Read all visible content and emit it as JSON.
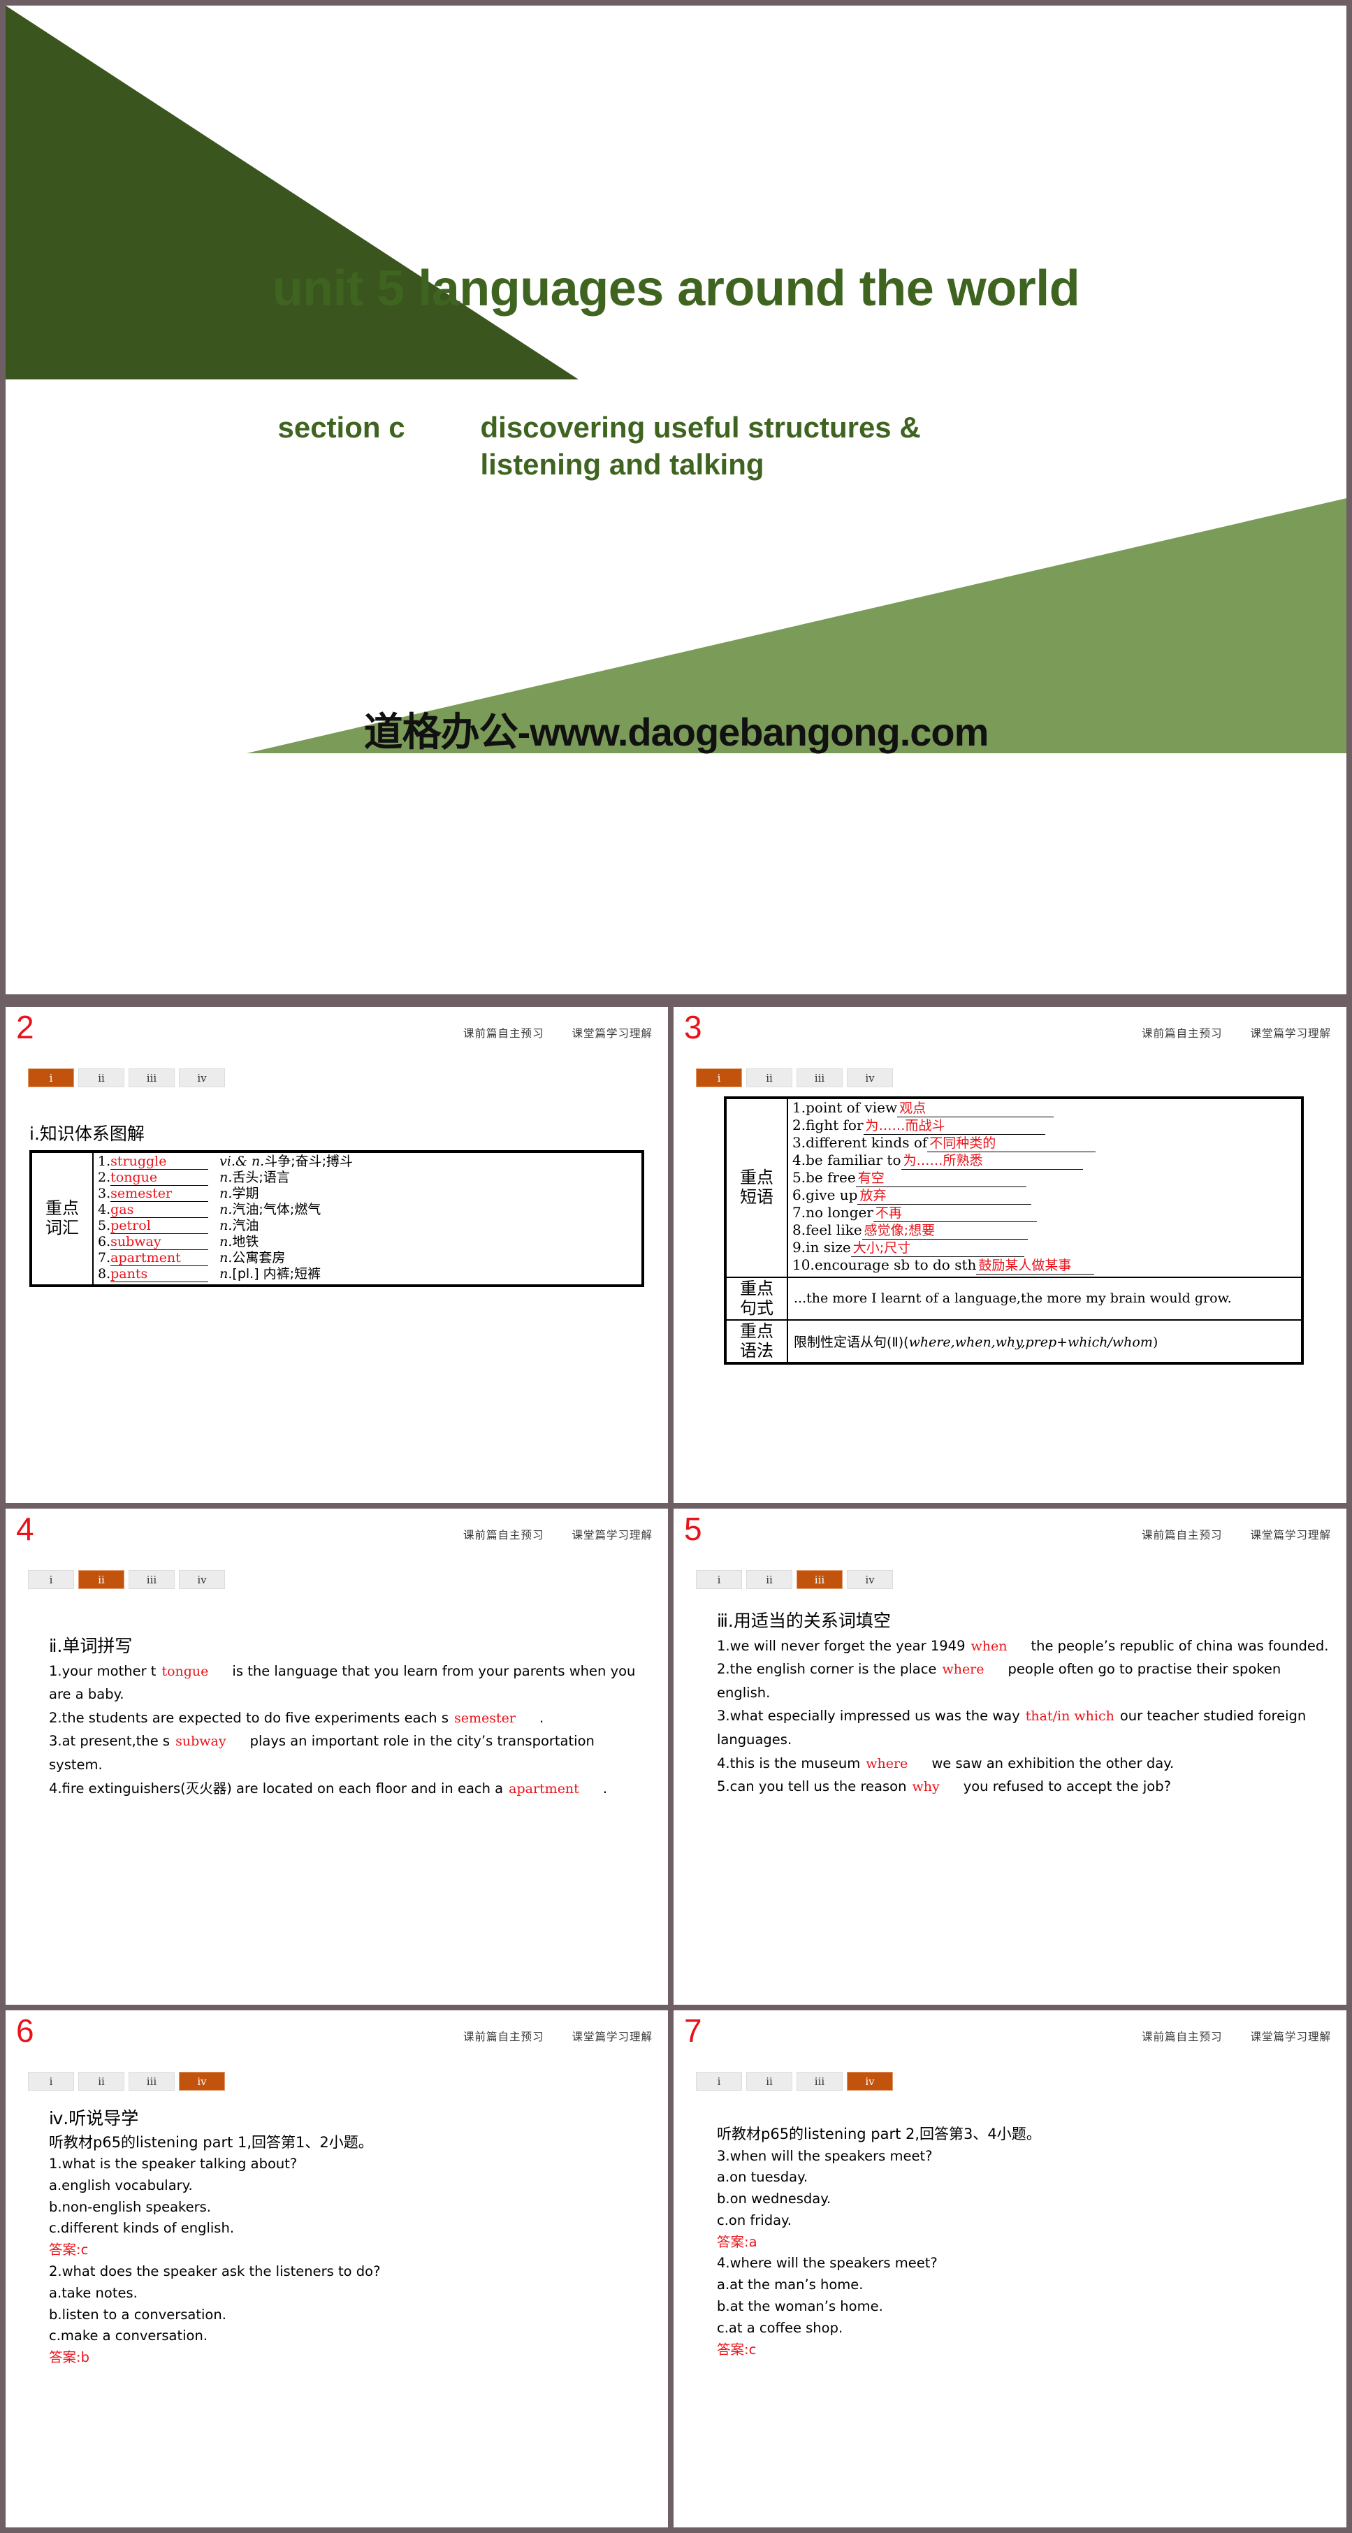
{
  "title_slide": {
    "main_title": "unit 5 languages around the world",
    "section_label": "section c",
    "subtitle_line1": "discovering useful structures &",
    "subtitle_line2": "listening and talking",
    "watermark": "道格办公-www.daogebangong.com",
    "colors": {
      "dark_green": "#3a551d",
      "light_green": "#7b9b58",
      "title_green": "#3e6420"
    }
  },
  "common": {
    "header_left": "课前篇自主预习",
    "header_right": "课堂篇学习理解",
    "tabs": [
      "i",
      "ii",
      "iii",
      "iv"
    ],
    "active_color": "#c1530d",
    "number_color": "#e8131a"
  },
  "slides": [
    {
      "number": "2",
      "active_tab": 0,
      "heading": "ⅰ.知识体系图解",
      "table": {
        "row_label": "重点\n词汇",
        "label_line1": "重点",
        "label_line2": "词汇",
        "vocab": [
          {
            "n": "1.",
            "word": "struggle",
            "pos": "vi.& n.",
            "def": "斗争;奋斗;搏斗"
          },
          {
            "n": "2.",
            "word": "tongue",
            "pos": "n.",
            "def": "舌头;语言"
          },
          {
            "n": "3.",
            "word": "semester",
            "pos": "n.",
            "def": "学期"
          },
          {
            "n": "4.",
            "word": "gas",
            "pos": "n.",
            "def": "汽油;气体;燃气"
          },
          {
            "n": "5.",
            "word": "petrol",
            "pos": "n.",
            "def": "汽油"
          },
          {
            "n": "6.",
            "word": "subway",
            "pos": "n.",
            "def": "地铁"
          },
          {
            "n": "7.",
            "word": "apartment",
            "pos": "n.",
            "def": "公寓套房"
          },
          {
            "n": "8.",
            "word": "pants",
            "pos": "n.",
            "def": "[pl.] 内裤;短裤"
          }
        ]
      }
    },
    {
      "number": "3",
      "active_tab": 0,
      "phrases_label_line1": "重点",
      "phrases_label_line2": "短语",
      "phrases": [
        {
          "n": "1.",
          "en": "point of view",
          "cn": "观点",
          "line": 180
        },
        {
          "n": "2.",
          "en": "fight for",
          "cn": "为……而战斗",
          "line": 140
        },
        {
          "n": "3.",
          "en": "different kinds of",
          "cn": "不同种类的",
          "line": 140
        },
        {
          "n": "4.",
          "en": "be familiar to",
          "cn": "为……所熟悉",
          "line": 140
        },
        {
          "n": "5.",
          "en": "be free",
          "cn": "有空",
          "line": 190
        },
        {
          "n": "6.",
          "en": "give up",
          "cn": "放弃",
          "line": 195
        },
        {
          "n": "7.",
          "en": "no longer",
          "cn": "不再",
          "line": 185
        },
        {
          "n": "8.",
          "en": "feel like",
          "cn": "感觉像;想要",
          "line": 130
        },
        {
          "n": "9.",
          "en": "in size",
          "cn": "大小;尺寸",
          "line": 150
        },
        {
          "n": "10.",
          "en": "encourage sb to do sth",
          "cn": "鼓励某人做某事",
          "line": 30
        }
      ],
      "sentence_label_line1": "重点",
      "sentence_label_line2": "句式",
      "sentence": "...the more I learnt of a language,the more my brain would grow.",
      "grammar_label_line1": "重点",
      "grammar_label_line2": "语法",
      "grammar_prefix": "限制性定语从句(Ⅱ)(",
      "grammar_italic": "where,when,why,prep+which/whom",
      "grammar_suffix": ")"
    },
    {
      "number": "4",
      "active_tab": 1,
      "heading": "ⅱ.单词拼写",
      "items": [
        {
          "pre": "1.your mother t",
          "ans": "tongue",
          "post": "is the language that you learn from your parents when you are a baby."
        },
        {
          "pre": "2.the students are expected to do five experiments each s",
          "ans": "semester",
          "post": "."
        },
        {
          "pre": "3.at present,the s",
          "ans": "subway",
          "post": "plays an important role in the city’s transportation system."
        },
        {
          "pre": "4.fire extinguishers(灭火器) are located on each floor and in each a",
          "ans": "apartment",
          "post": "."
        }
      ]
    },
    {
      "number": "5",
      "active_tab": 2,
      "heading": "ⅲ.用适当的关系词填空",
      "items": [
        {
          "pre": "1.we will never forget the year 1949",
          "ans": "when",
          "post": "the people’s republic of china was founded."
        },
        {
          "pre": "2.the english corner is the place",
          "ans": "where",
          "post": "people often go to practise their spoken english."
        },
        {
          "pre": "3.what especially impressed us was the way",
          "ans": "that/in which",
          "post": "our teacher studied foreign languages."
        },
        {
          "pre": "4.this is the museum",
          "ans": "where",
          "post": "we saw an exhibition the other day."
        },
        {
          "pre": "5.can you tell us the reason",
          "ans": "why",
          "post": "you refused to accept the job?"
        }
      ]
    },
    {
      "number": "6",
      "active_tab": 3,
      "heading": "ⅳ.听说导学",
      "instruction": "听教材p65的listening part 1,回答第1、2小题。",
      "questions": [
        {
          "q": "1.what is the speaker talking about?",
          "options": [
            "a.english vocabulary.",
            "b.non-english speakers.",
            "c.different kinds of english."
          ],
          "answer": "答案:c"
        },
        {
          "q": "2.what does the speaker ask the listeners to do?",
          "options": [
            "a.take notes.",
            "b.listen to a conversation.",
            "c.make a conversation."
          ],
          "answer": "答案:b"
        }
      ]
    },
    {
      "number": "7",
      "active_tab": 3,
      "instruction": "听教材p65的listening part 2,回答第3、4小题。",
      "questions": [
        {
          "q": "3.when will the speakers meet?",
          "options": [
            "a.on tuesday.",
            "b.on wednesday.",
            "c.on friday."
          ],
          "answer": "答案:a"
        },
        {
          "q": "4.where will the speakers meet?",
          "options": [
            "a.at the man’s home.",
            "b.at the woman’s home.",
            "c.at a coffee shop."
          ],
          "answer": "答案:c"
        }
      ]
    }
  ]
}
